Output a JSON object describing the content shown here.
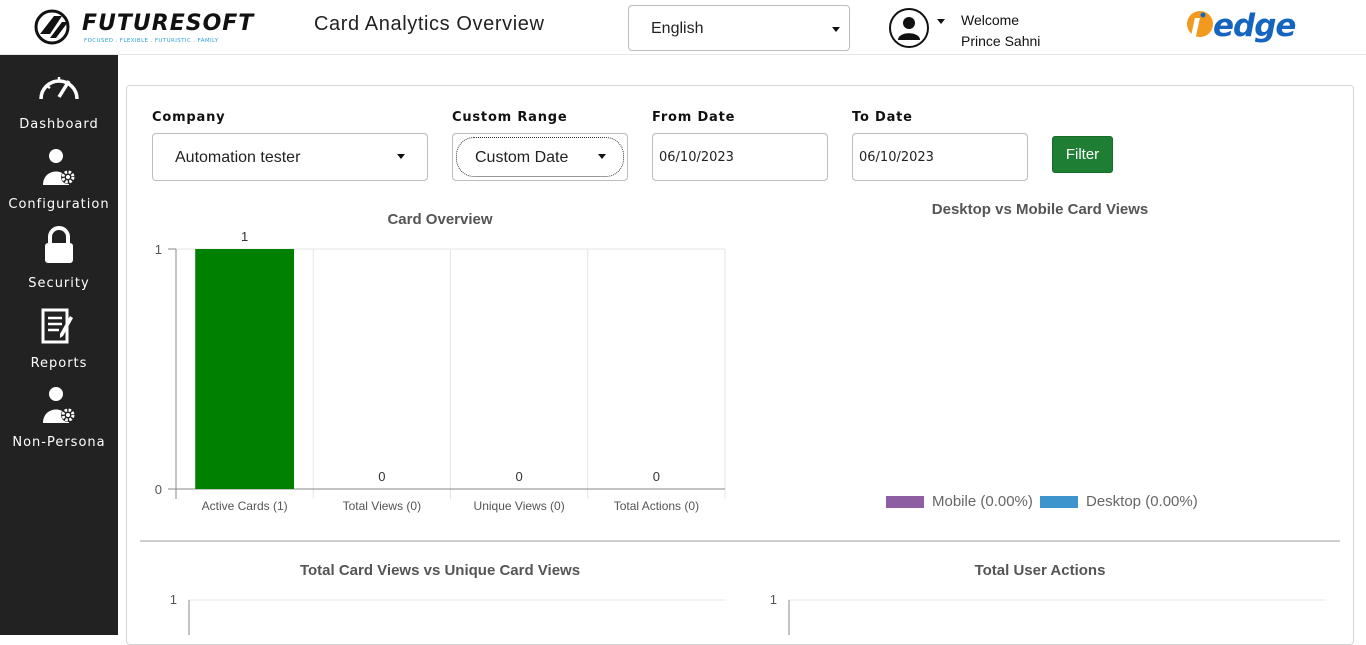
{
  "header": {
    "logo_text": "FUTURESOFT",
    "logo_tagline": "FOCUSED . FLEXIBLE . FUTURISTIC . FAMILY",
    "page_title": "Card Analytics Overview",
    "language": "English",
    "welcome_label": "Welcome",
    "user_name": "Prince Sahni",
    "partner_logo_text": "edge"
  },
  "sidebar": {
    "items": [
      {
        "label": "Dashboard",
        "icon": "speedometer-icon"
      },
      {
        "label": "Configuration",
        "icon": "user-gear-icon"
      },
      {
        "label": "Security",
        "icon": "lock-icon"
      },
      {
        "label": "Reports",
        "icon": "clipboard-icon"
      },
      {
        "label": "Non-Persona",
        "icon": "user-gear-icon"
      }
    ]
  },
  "filters": {
    "company_label": "Company",
    "company_value": "Automation tester",
    "range_label": "Custom Range",
    "range_value": "Custom Date",
    "from_label": "From Date",
    "from_value": "06/10/2023",
    "to_label": "To Date",
    "to_value": "06/10/2023",
    "filter_button": "Filter",
    "filter_color": "#1e7e34"
  },
  "chart_data": [
    {
      "type": "bar",
      "title": "Card Overview",
      "categories": [
        "Active Cards (1)",
        "Total Views (0)",
        "Unique Views (0)",
        "Total Actions (0)"
      ],
      "values": [
        1,
        0,
        0,
        0
      ],
      "ylim": [
        0,
        1
      ],
      "yticks": [
        "1",
        "0"
      ],
      "color": "#008000",
      "grid": true
    },
    {
      "type": "pie",
      "title": "Desktop vs Mobile Card Views",
      "series": [
        {
          "name": "Mobile (0.00%)",
          "value": 0,
          "color": "#8e5ea2"
        },
        {
          "name": "Desktop (0.00%)",
          "value": 0,
          "color": "#3e95cd"
        }
      ],
      "legend": "bottom"
    },
    {
      "type": "line",
      "title": "Total Card Views vs Unique Card Views",
      "yticks": [
        "1"
      ]
    },
    {
      "type": "line",
      "title": "Total User Actions",
      "yticks": [
        "1"
      ]
    }
  ]
}
